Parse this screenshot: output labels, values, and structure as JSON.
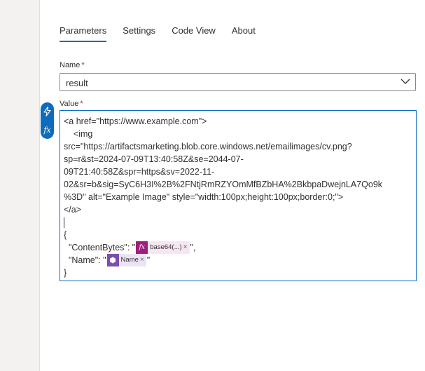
{
  "tabs": [
    {
      "label": "Parameters",
      "active": true
    },
    {
      "label": "Settings",
      "active": false
    },
    {
      "label": "Code View",
      "active": false
    },
    {
      "label": "About",
      "active": false
    }
  ],
  "name_field": {
    "label": "Name",
    "required_mark": "*",
    "value": "result"
  },
  "value_field": {
    "label": "Value",
    "required_mark": "*",
    "lines": [
      "<a href=\"https://www.example.com\">",
      "    <img",
      "src=\"https://artifactsmarketing.blob.core.windows.net/emailimages/cv.png?",
      "sp=r&st=2024-07-09T13:40:58Z&se=2044-07-",
      "09T21:40:58Z&spr=https&sv=2022-11-",
      "02&sr=b&sig=SyC6H3I%2B%2FNtjRmRZYOmMfBZbHA%2BkbpaDwejnLA7Qo9k",
      "%3D\" alt=\"Example Image\" style=\"width:100px;height:100px;border:0;\">",
      "</a>"
    ],
    "json_open": "{",
    "content_bytes_prefix": "  \"ContentBytes\": \"",
    "content_bytes_token": "base64(...)",
    "content_bytes_suffix": "\",",
    "name_prefix": "  \"Name\": \"",
    "name_token": "Name",
    "name_suffix": "\"",
    "json_close": "}"
  },
  "token_close_glyph": "×",
  "fx_glyph": "fx",
  "icons": {
    "dynamic_content": "lightning-icon",
    "expression": "fx-icon",
    "dropdown": "chevron-down-icon",
    "dynamic_token": "hexagon-icon"
  },
  "colors": {
    "accent": "#0f6cbd",
    "fx_token": "#9c1f7a",
    "dynamic_token": "#7a4fb0",
    "required": "#a4262c"
  }
}
